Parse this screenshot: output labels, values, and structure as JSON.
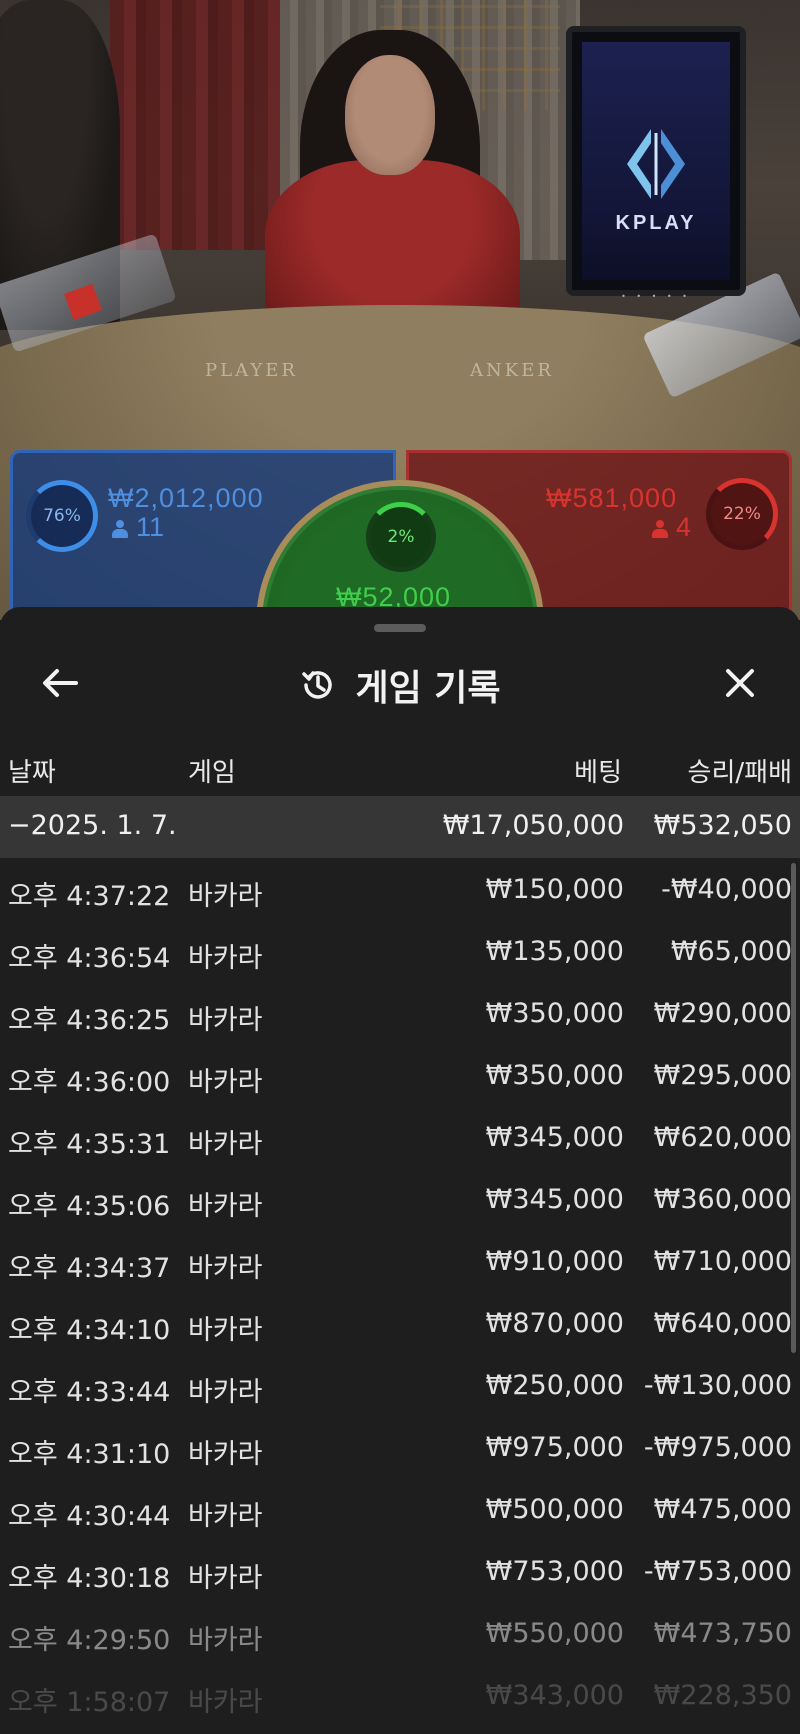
{
  "video": {
    "table_player_text": "PLAYER",
    "table_banker_text": "ANKER",
    "monitor_brand": "KPLAY",
    "monitor_dots": "• • • • •"
  },
  "betting": {
    "player": {
      "percent": "76%",
      "amount": "₩2,012,000",
      "players": "11",
      "fill": 0.76,
      "color": "#3d8ee8"
    },
    "banker": {
      "percent": "22%",
      "amount": "₩581,000",
      "players": "4",
      "fill": 0.22,
      "color": "#d8332f"
    },
    "tie": {
      "percent": "2%",
      "amount": "₩52,000",
      "fill": 0.02,
      "color": "#3fcf4a"
    }
  },
  "history": {
    "title": "게임 기록",
    "icons": {
      "back": "arrow-left-icon",
      "title": "history-icon",
      "close": "close-icon"
    },
    "columns": {
      "date": "날짜",
      "game": "게임",
      "bet": "베팅",
      "result": "승리/패배"
    },
    "date_group": {
      "date": "−2025. 1. 7.",
      "bet_total": "₩17,050,000",
      "result_total": "₩532,050"
    },
    "rows": [
      {
        "time": "오후 4:37:22",
        "game": "바카라",
        "bet": "₩150,000",
        "result": "-₩40,000"
      },
      {
        "time": "오후 4:36:54",
        "game": "바카라",
        "bet": "₩135,000",
        "result": "₩65,000"
      },
      {
        "time": "오후 4:36:25",
        "game": "바카라",
        "bet": "₩350,000",
        "result": "₩290,000"
      },
      {
        "time": "오후 4:36:00",
        "game": "바카라",
        "bet": "₩350,000",
        "result": "₩295,000"
      },
      {
        "time": "오후 4:35:31",
        "game": "바카라",
        "bet": "₩345,000",
        "result": "₩620,000"
      },
      {
        "time": "오후 4:35:06",
        "game": "바카라",
        "bet": "₩345,000",
        "result": "₩360,000"
      },
      {
        "time": "오후 4:34:37",
        "game": "바카라",
        "bet": "₩910,000",
        "result": "₩710,000"
      },
      {
        "time": "오후 4:34:10",
        "game": "바카라",
        "bet": "₩870,000",
        "result": "₩640,000"
      },
      {
        "time": "오후 4:33:44",
        "game": "바카라",
        "bet": "₩250,000",
        "result": "-₩130,000"
      },
      {
        "time": "오후 4:31:10",
        "game": "바카라",
        "bet": "₩975,000",
        "result": "-₩975,000"
      },
      {
        "time": "오후 4:30:44",
        "game": "바카라",
        "bet": "₩500,000",
        "result": "₩475,000"
      },
      {
        "time": "오후 4:30:18",
        "game": "바카라",
        "bet": "₩753,000",
        "result": "-₩753,000"
      },
      {
        "time": "오후 4:29:50",
        "game": "바카라",
        "bet": "₩550,000",
        "result": "₩473,750"
      },
      {
        "time": "오후 1:58:07",
        "game": "바카라",
        "bet": "₩343,000",
        "result": "₩228,350"
      }
    ]
  }
}
